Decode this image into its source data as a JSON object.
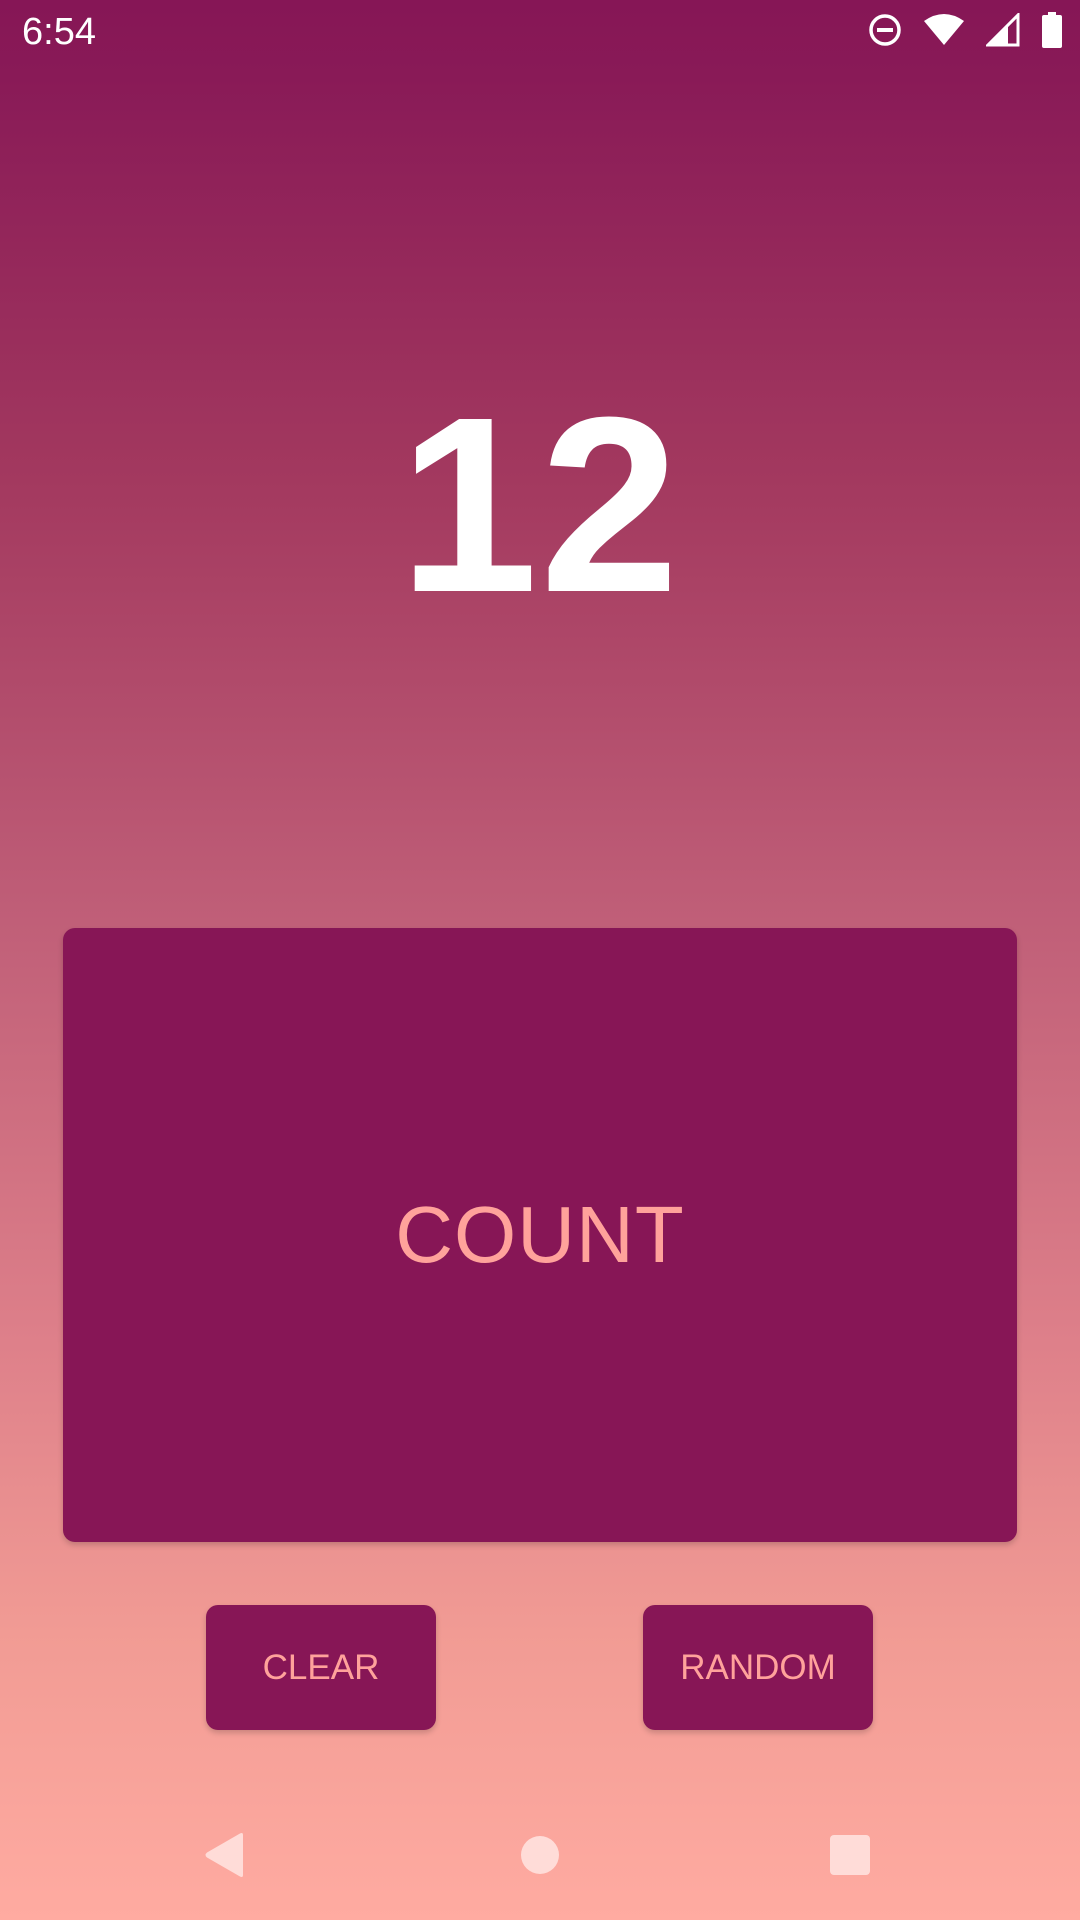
{
  "status_bar": {
    "time": "6:54",
    "icons": [
      "do-not-disturb-icon",
      "wifi-icon",
      "cell-signal-icon",
      "battery-icon"
    ]
  },
  "counter": {
    "value": "12"
  },
  "buttons": {
    "count_label": "COUNT",
    "clear_label": "CLEAR",
    "random_label": "RANDOM"
  },
  "nav_bar": {
    "icons": [
      "back-icon",
      "home-icon",
      "recents-icon"
    ]
  },
  "colors": {
    "button_bg": "#871656",
    "button_text": "#ffa29b",
    "gradient_top": "#861656",
    "gradient_bottom": "#ffaba1",
    "counter_text": "#ffffff"
  }
}
